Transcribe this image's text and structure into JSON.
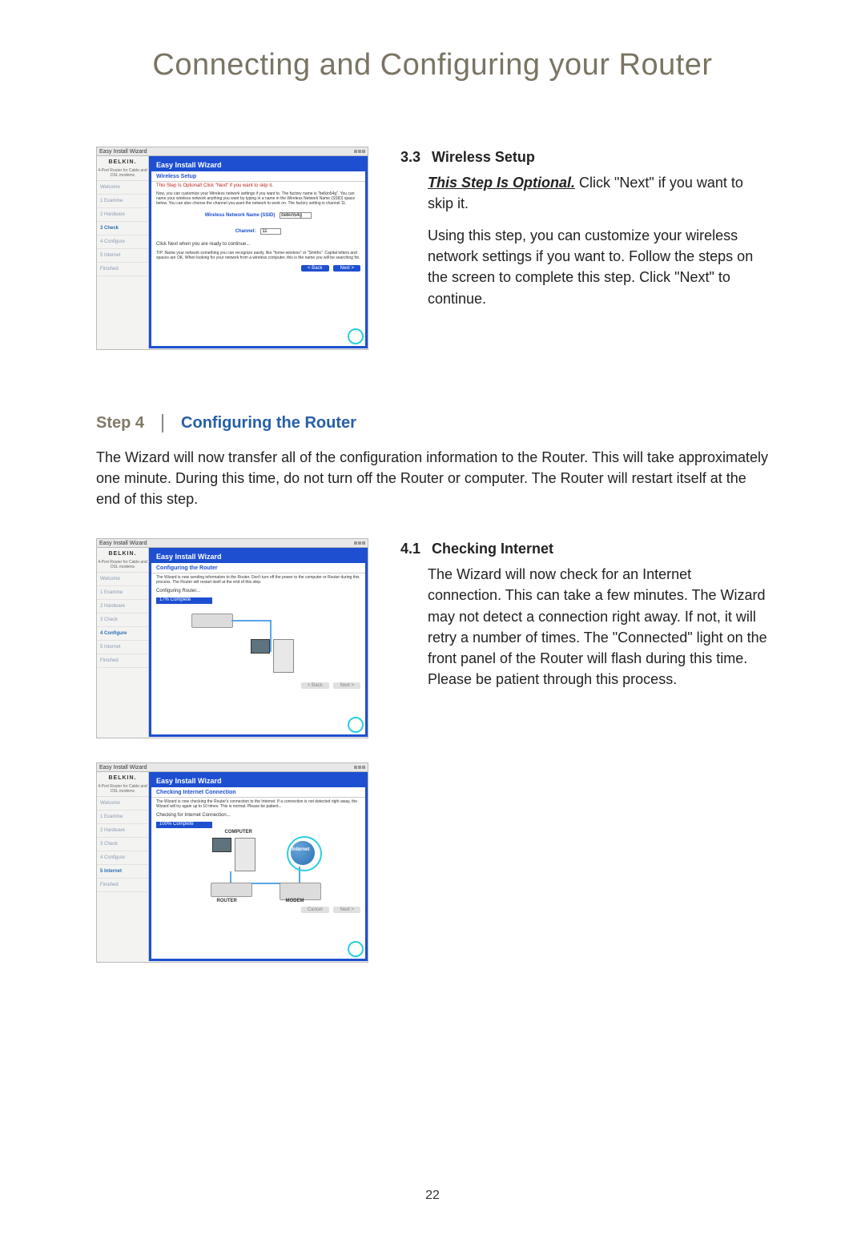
{
  "page_title": "Connecting and Configuring your Router",
  "page_number": "22",
  "sec33": {
    "num": "3.3",
    "title": "Wireless Setup",
    "line1_emph": "This Step Is Optional.",
    "line1_rest": " Click \"Next\" if you want to skip it.",
    "body": "Using this step, you can customize your wireless network settings if you want to. Follow the steps on the screen to complete this step. Click \"Next\" to continue."
  },
  "step4": {
    "label": "Step 4",
    "title": "Configuring the Router",
    "body": "The Wizard will now transfer all of the configuration information to the Router. This will take approximately one minute. During this time, do not turn off the Router or computer. The Router will restart itself at the end of this step."
  },
  "sec41": {
    "num": "4.1",
    "title": "Checking Internet",
    "body": "The Wizard will now check for an Internet connection. This can take a few minutes. The Wizard may not detect a connection right away. If not, it will retry a number of times. The \"Connected\" light on the front panel of the Router will flash during this time. Please be patient through this process."
  },
  "wizard_common": {
    "window_title": "Easy Install Wizard",
    "logo": "BELKIN.",
    "sublogo": "4-Port Router for Cable and DSL modems",
    "header": "Easy Install Wizard",
    "nav": [
      "Welcome",
      "1 Examine",
      "2 Hardware",
      "3 Check",
      "4 Configure",
      "5 Internet",
      "Finished"
    ]
  },
  "shot1": {
    "subtitle": "Wireless Setup",
    "warn": "This Step Is Optional! Click \"Next\" if you want to skip it.",
    "desc": "Now, you can customize your Wireless network settings if you want to. The factory name is \"belkin54g\". You can name your wireless network anything you want by typing in a name in the Wireless Network Name (SSID) space below. You can also choose the channel you want the network to work on. The factory setting is channel 11.",
    "field_ssid_label": "Wireless Network Name (SSID)",
    "field_ssid_value": "belkin54g",
    "field_channel_label": "Channel:",
    "field_channel_value": "11",
    "note": "Click Next when you are ready to continue...",
    "tip": "TIP: Name your network something you can recognize easily, like \"home-wireless\" or \"Smiths\". Capital letters and spaces are OK. When looking for your network from a wireless computer, this is the name you will be searching for.",
    "btn_back": "< Back",
    "btn_next": "Next >",
    "active_nav": 3
  },
  "shot2": {
    "subtitle": "Configuring the Router",
    "desc": "The Wizard is now sending information to the Router. Don't turn off the power to the computer or Router during this process. The Router will restart itself at the end of this step.",
    "status": "Configuring Router...",
    "progress": "17% Complete",
    "btn_back": "< Back",
    "btn_next": "Next >",
    "active_nav": 4
  },
  "shot3": {
    "subtitle": "Checking Internet Connection",
    "desc": "The Wizard is now checking the Router's connection to the Internet. If a connection is not detected right away, the Wizard will try again up to 10 times. This is normal. Please be patient...",
    "status": "Checking for Internet Connection...",
    "progress": "100% Complete",
    "label_computer": "COMPUTER",
    "label_router": "ROUTER",
    "label_modem": "MODEM",
    "label_internet": "Internet",
    "btn_cancel": "Cancel",
    "btn_next": "Next >",
    "active_nav": 5
  }
}
